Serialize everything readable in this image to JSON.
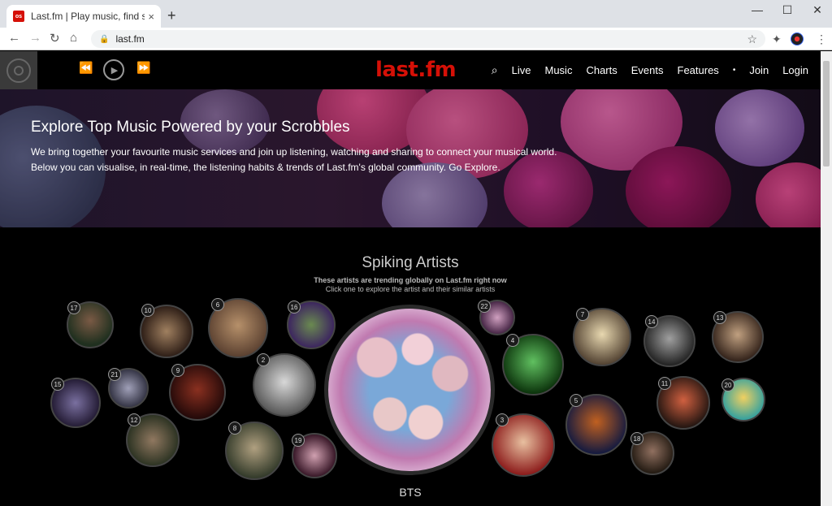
{
  "browser": {
    "tab_title": "Last.fm | Play music, find songs, a",
    "favicon_text": "os",
    "url": "last.fm",
    "new_tab": "+",
    "tab_close": "×",
    "back": "←",
    "forward": "→",
    "reload": "↻",
    "home": "⌂",
    "lock": "🔒",
    "star": "☆",
    "extensions": "✦",
    "menu": "⋮",
    "minimize": "—",
    "maximize": "☐",
    "close": "✕"
  },
  "nav": {
    "logo": "last.fm",
    "prev_icon": "⏪",
    "play_icon": "▶",
    "next_icon": "⏩",
    "search_icon": "⌕",
    "links": [
      "Live",
      "Music",
      "Charts",
      "Events",
      "Features"
    ],
    "dot": "•",
    "join": "Join",
    "login": "Login"
  },
  "hero": {
    "title": "Explore Top Music Powered by your Scrobbles",
    "line1": "We bring together your favourite music services and join up listening, watching and sharing to connect your musical world.",
    "line2": "Below you can visualise, in real-time, the listening habits & trends of Last.fm's global community. Go Explore."
  },
  "spiking": {
    "title": "Spiking Artists",
    "subtitle_bold": "These artists are trending globally on Last.fm right now",
    "subtitle": "Click one to explore the artist and their similar artists",
    "featured": "BTS",
    "ranks": [
      "17",
      "10",
      "6",
      "16",
      "2",
      "9",
      "21",
      "15",
      "12",
      "8",
      "19",
      "22",
      "4",
      "3",
      "7",
      "5",
      "14",
      "13",
      "11",
      "20",
      "18"
    ],
    "colors": {
      "accent": "#d51007"
    }
  }
}
